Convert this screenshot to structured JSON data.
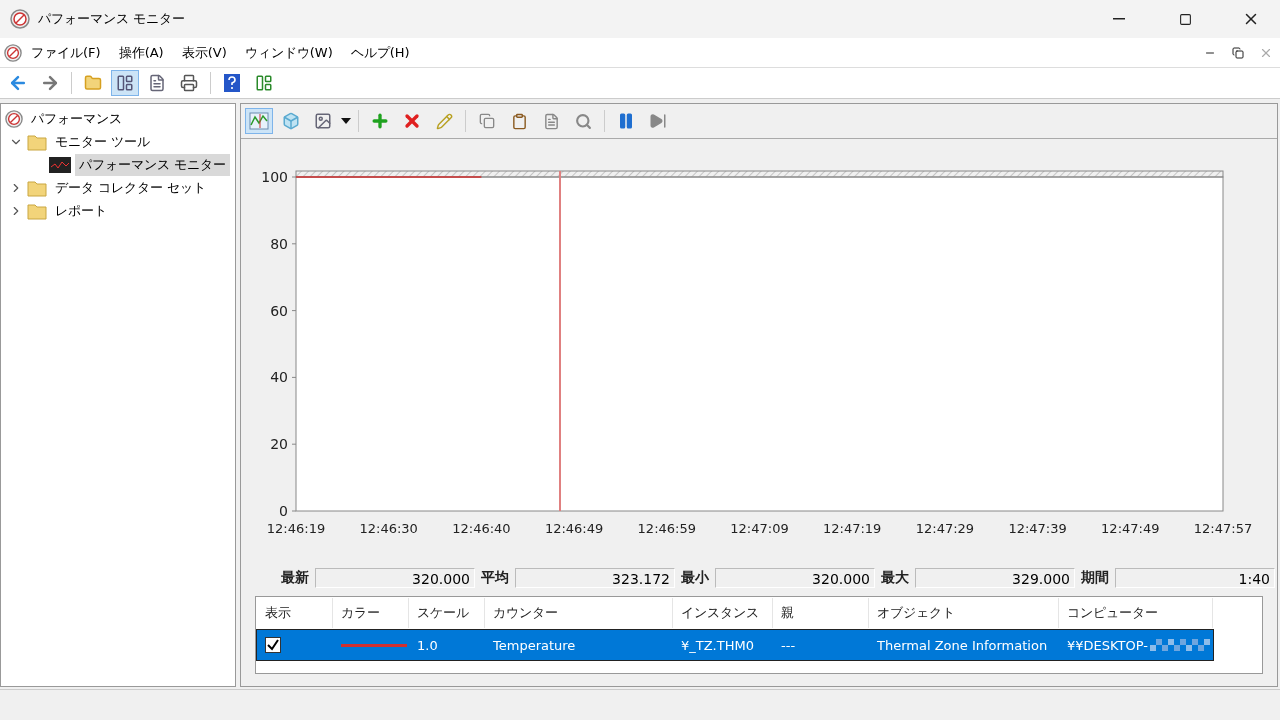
{
  "window": {
    "title": "パフォーマンス モニター"
  },
  "menu": [
    "ファイル(F)",
    "操作(A)",
    "表示(V)",
    "ウィンドウ(W)",
    "ヘルプ(H)"
  ],
  "main_toolbar": [
    {
      "pressed": false
    },
    {
      "pressed": false
    },
    {
      "pressed": false
    },
    {
      "pressed": true
    },
    {
      "pressed": false
    },
    {
      "pressed": false
    },
    {
      "pressed": false
    },
    {
      "pressed": false
    }
  ],
  "tree": {
    "label": "パフォーマンス",
    "selected": false,
    "children": [
      {
        "label": "モニター ツール",
        "expanded": true,
        "selected": false,
        "children": [
          {
            "label": "パフォーマンス モニター",
            "selected": true
          }
        ]
      },
      {
        "label": "データ コレクター セット",
        "expanded": false,
        "selected": false
      },
      {
        "label": "レポート",
        "expanded": false,
        "selected": false
      }
    ]
  },
  "graph_toolbar": [
    {
      "pressed": true
    },
    {
      "pressed": false
    },
    {
      "pressed": false
    },
    {
      "pressed": false
    },
    {
      "pressed": false
    },
    {
      "pressed": false
    },
    {
      "pressed": false
    },
    {
      "pressed": false
    },
    {
      "pressed": false
    },
    {
      "pressed": false
    },
    {
      "pressed": false
    },
    {
      "pressed": false
    }
  ],
  "chart": {
    "chart_data": {
      "type": "line",
      "x": [
        "12:46:19",
        "12:46:30",
        "12:46:40",
        "12:46:49",
        "12:46:59",
        "12:47:09",
        "12:47:19",
        "12:47:29",
        "12:47:39",
        "12:47:49",
        "12:47:57"
      ],
      "ylim": [
        0,
        100
      ],
      "yticks": [
        0,
        20,
        40,
        60,
        80,
        100
      ],
      "series": [
        {
          "color": "#d03030",
          "values": [
            100,
            100,
            100,
            null,
            null,
            null,
            null,
            null,
            null,
            null,
            null
          ]
        }
      ]
    }
  },
  "stats": [
    {
      "label": "最新",
      "value": "320.000"
    },
    {
      "label": "平均",
      "value": "323.172"
    },
    {
      "label": "最小",
      "value": "320.000"
    },
    {
      "label": "最大",
      "value": "329.000"
    },
    {
      "label": "期間",
      "value": "1:40"
    }
  ],
  "counters": {
    "columns": [
      "表示",
      "カラー",
      "スケール",
      "カウンター",
      "インスタンス",
      "親",
      "オブジェクト",
      "コンピューター"
    ],
    "rows": [
      {
        "selected": true,
        "shown": true,
        "color": "#d03030",
        "cells": [
          "",
          "",
          "1.0",
          "Temperature",
          "¥_TZ.THM0",
          "---",
          "Thermal Zone Information",
          "¥¥DESKTOP-"
        ]
      }
    ]
  }
}
